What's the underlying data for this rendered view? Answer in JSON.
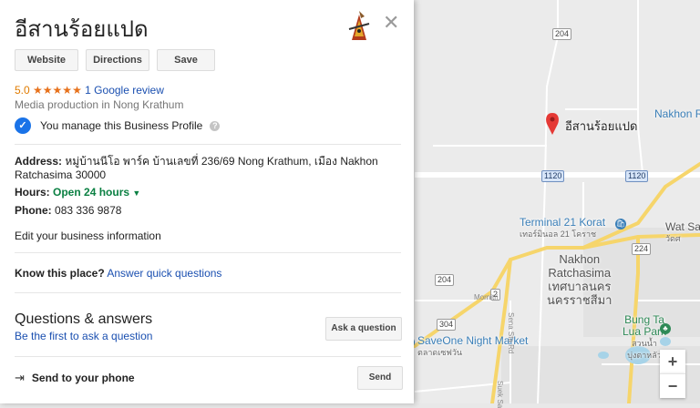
{
  "business": {
    "name": "อีสานร้อยแปด",
    "buttons": {
      "website": "Website",
      "directions": "Directions",
      "save": "Save"
    },
    "rating": {
      "value": "5.0",
      "stars": "★★★★★",
      "reviews_link": "1 Google review"
    },
    "category": "Media production in Nong Krathum",
    "manage_text": "You manage this Business Profile",
    "address_label": "Address:",
    "address_line1": "หมู่บ้านนีโอ พาร์ค บ้านเลขที่ 236/69 Nong Krathum, เมือง Nakhon",
    "address_line2": "Ratchasima 30000",
    "hours_label": "Hours:",
    "hours_value": "Open 24 hours",
    "phone_label": "Phone:",
    "phone_value": "083 336 9878",
    "edit_link": "Edit your business information",
    "know_label": "Know this place?",
    "know_link": "Answer quick questions",
    "qa_title": "Questions & answers",
    "qa_link": "Be the first to ask a question",
    "ask_button": "Ask a question",
    "send_label": "Send to your phone",
    "send_button": "Send"
  },
  "icons": {
    "close": "close-icon",
    "verified": "verified-check-icon",
    "help": "help-icon",
    "send": "send-to-phone-icon",
    "pin": "map-pin-icon"
  },
  "map": {
    "pin_label": "อีสานร้อยแปด",
    "roads": [
      "204",
      "1120",
      "1120",
      "224",
      "204",
      "2",
      "304"
    ],
    "city_en": "Nakhon",
    "city_en2": "Ratchasima",
    "city_th": "เทศบาลนคร",
    "city_th2": "นครราชสีมา",
    "nakhon_edge": "Nakhon R",
    "terminal": "Terminal 21 Korat",
    "terminal_th": "เทอร์มินอล 21 โคราช",
    "wat": "Wat Sa",
    "wat_th": "วัดศ",
    "bung1": "Bung Ta",
    "bung2": "Lua Park",
    "bung_th1": "สวนน้ำ",
    "bung_th2": "บุ่งตาหลัว",
    "saveone": "SaveOne Night Market",
    "saveone_th": "ตลาดเซฟวัน",
    "street1": "Mornitri",
    "street2": "Sena Sta Rd",
    "street3": "Suek Sa",
    "zoom_in": "+",
    "zoom_out": "−"
  },
  "colors": {
    "pin": "#e53935",
    "road_yellow": "#f6d56b",
    "link": "#1a4fb0",
    "open": "#0b8043",
    "star": "#e7711b"
  }
}
